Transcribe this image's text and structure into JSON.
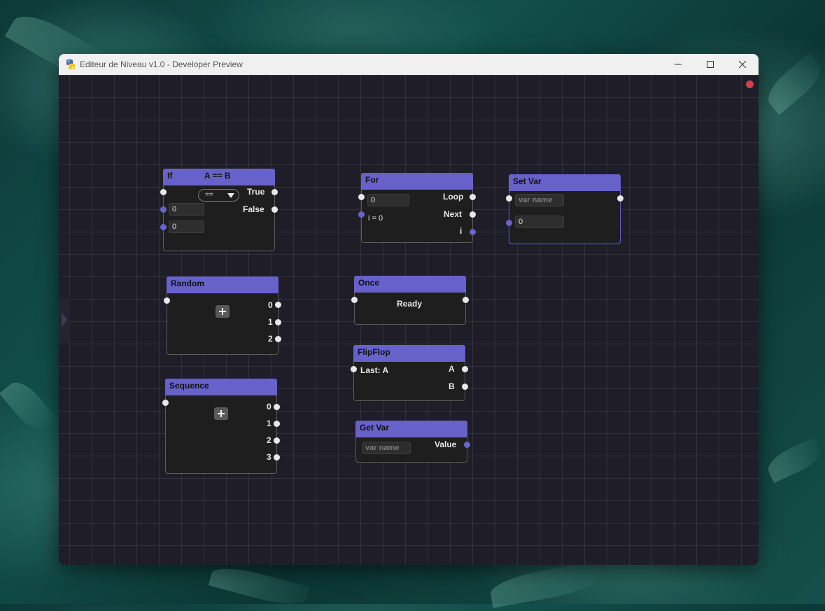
{
  "window": {
    "title": "Editeur de Niveau v1.0 - Developer Preview",
    "controls": {
      "minimize": "minimize-icon",
      "maximize": "maximize-icon",
      "close": "close-icon"
    }
  },
  "colors": {
    "node_header": "#6762c9",
    "data_port": "#6a63cc",
    "status_dot": "#d0404e",
    "canvas": "#1f1e28"
  },
  "nodes": {
    "if": {
      "title": "If",
      "condition": "A == B",
      "operator": "==",
      "input_a": "0",
      "input_b": "0",
      "out_true": "True",
      "out_false": "False"
    },
    "for": {
      "title": "For",
      "count": "0",
      "index_label": "i = 0",
      "out_loop": "Loop",
      "out_next": "Next",
      "out_i": "i"
    },
    "set_var": {
      "title": "Set Var",
      "name_placeholder": "var name",
      "value": "0"
    },
    "random": {
      "title": "Random",
      "outputs": [
        "0",
        "1",
        "2"
      ]
    },
    "once": {
      "title": "Once",
      "state": "Ready"
    },
    "flipflop": {
      "title": "FlipFlop",
      "last": "Last: A",
      "out_a": "A",
      "out_b": "B"
    },
    "sequence": {
      "title": "Sequence",
      "outputs": [
        "0",
        "1",
        "2",
        "3"
      ]
    },
    "get_var": {
      "title": "Get Var",
      "name_placeholder": "var name",
      "out_value": "Value"
    }
  }
}
